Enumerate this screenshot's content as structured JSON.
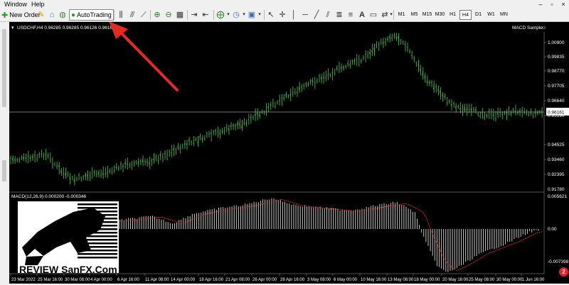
{
  "menu": {
    "items": [
      "Window",
      "Help"
    ]
  },
  "toolbar": {
    "new_order_label": "New Order",
    "autotrading_label": "AutoTrading",
    "timeframes": [
      "M1",
      "M5",
      "M15",
      "M30",
      "H1",
      "H4",
      "D1",
      "W1",
      "MN"
    ],
    "active_timeframe": "H4"
  },
  "chart": {
    "symbol_line": "USDCHF,H4  0.96285 0.96285 0.96126 0.96161",
    "expert": "MACD Sample",
    "current_price": "0.96161",
    "price_labels": [
      "1.00900",
      "0.99835",
      "0.98770",
      "0.97705",
      "0.96640",
      "0.95590",
      "0.94525",
      "0.93460",
      "0.92395"
    ],
    "macd_header": "MACD(12,26,9) 0.000200 -0.000346",
    "macd_labels": [
      "0.005621",
      "0.00",
      "-0.007398"
    ],
    "time_labels": [
      "23 Mar 2022",
      "25 Mar 16:00",
      "30 Mar 08:00",
      "4 Apr 00:00",
      "6 Apr 16:00",
      "11 Apr 08:00",
      "14 Apr 00:00",
      "18 Apr 16:00",
      "21 Apr 08:00",
      "26 Apr 00:00",
      "28 Apr 16:00",
      "3 May 08:00",
      "6 May 00:00",
      "10 May 16:00",
      "13 May 08:00",
      "18 May 00:00",
      "20 May 16:00",
      "25 May 08:00",
      "30 May 00:00",
      "1 Jun 16:00"
    ],
    "watermark": "REVIEW SanFX.Com"
  },
  "badge": {
    "count": "2"
  },
  "colors": {
    "candle": "#4caf50",
    "macd_hist": "#d8d8d8",
    "signal": "#e03030",
    "arrow": "#e02b20",
    "price_line": "#aaaaaa"
  }
}
